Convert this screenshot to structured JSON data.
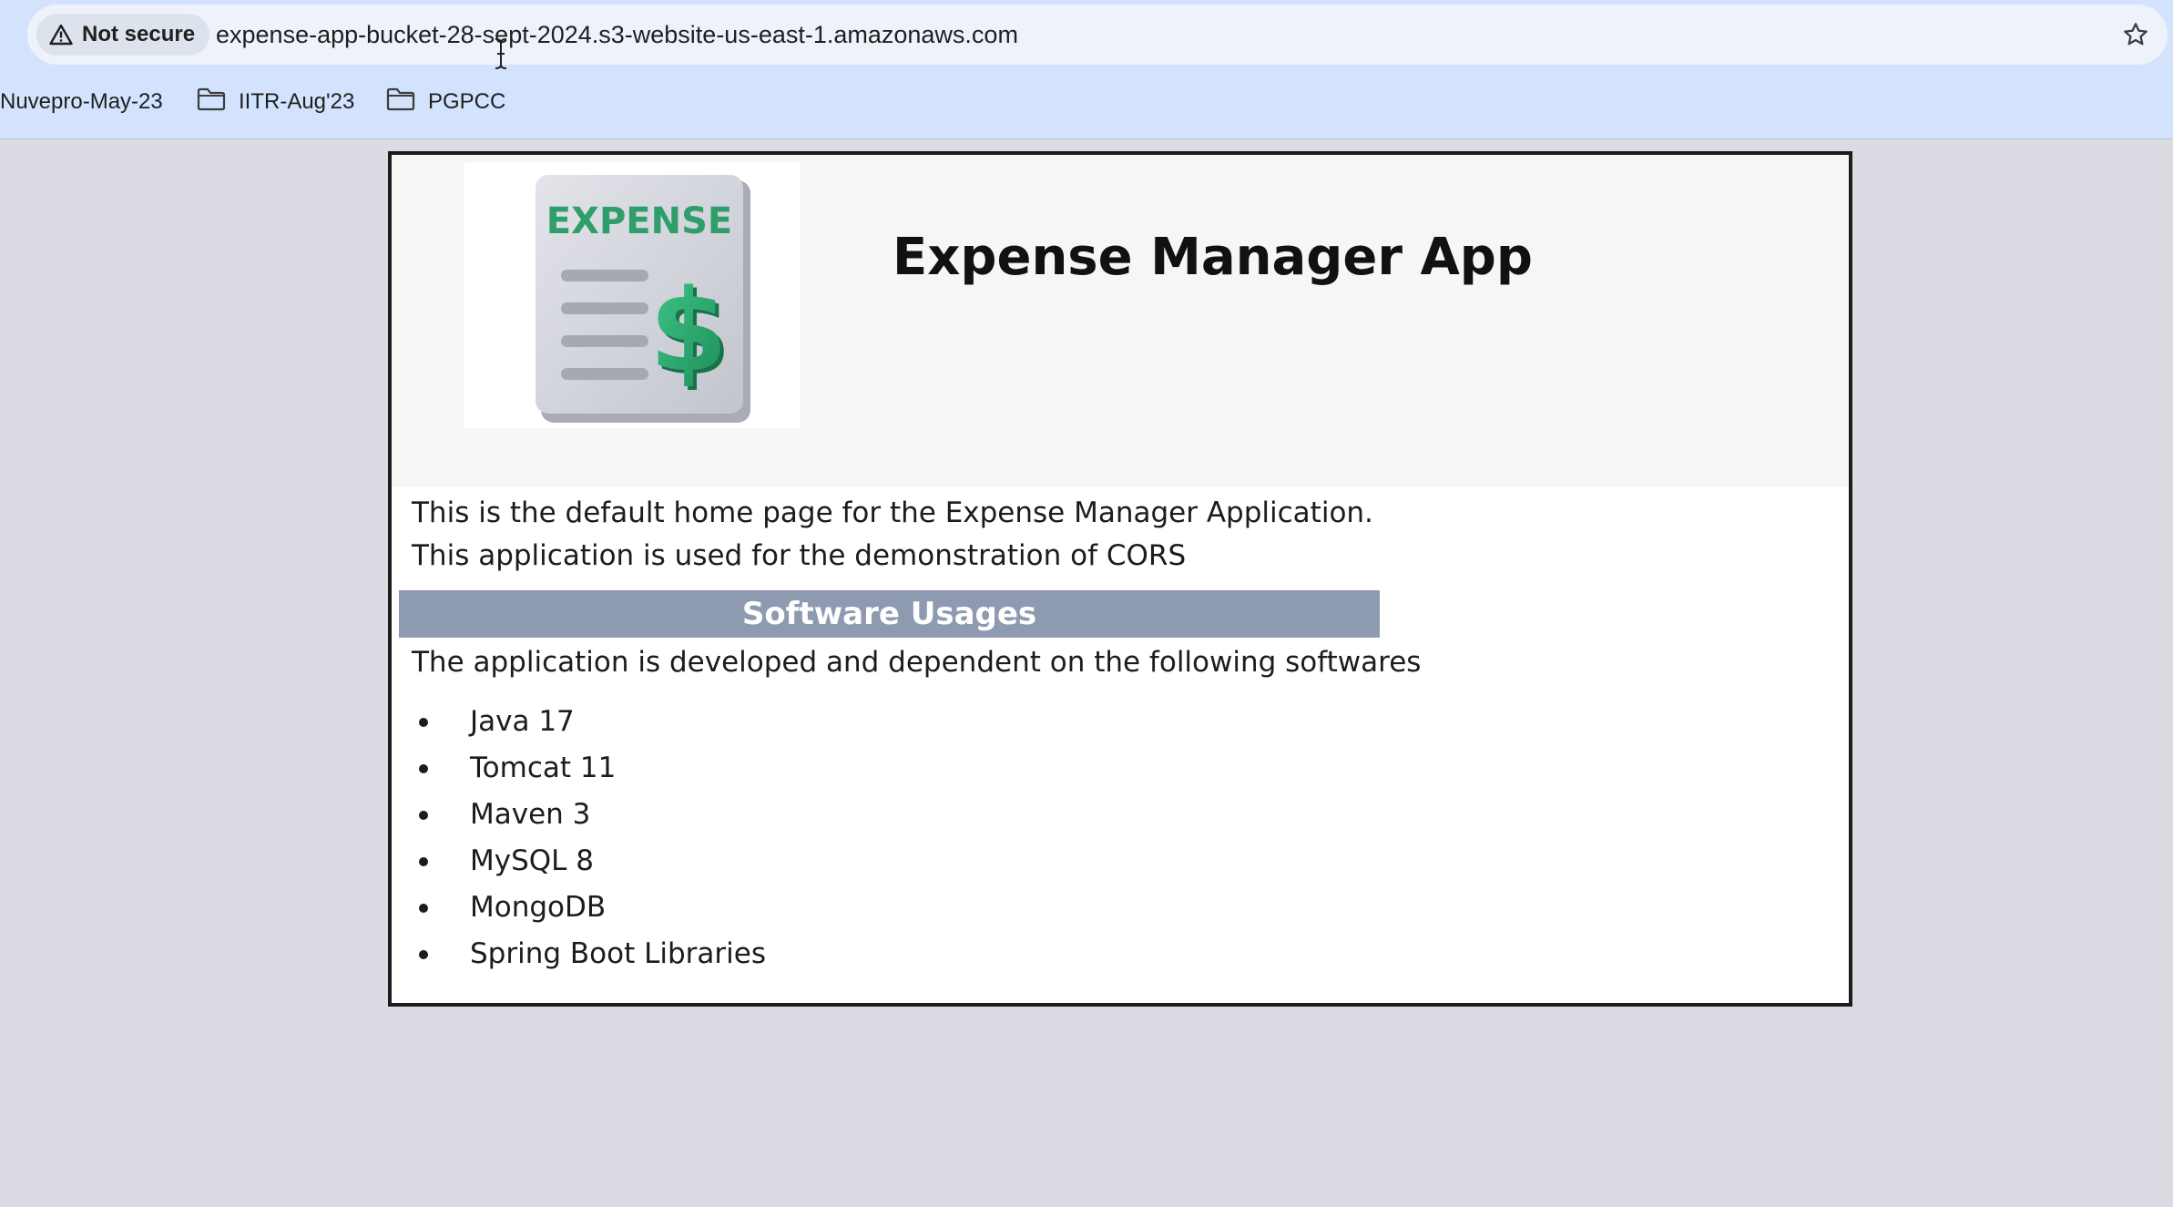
{
  "browser": {
    "security_label": "Not secure",
    "url": "expense-app-bucket-28-sept-2024.s3-website-us-east-1.amazonaws.com",
    "bookmarks": [
      {
        "label": "Nuvepro-May-23"
      },
      {
        "label": "IITR-Aug'23"
      },
      {
        "label": "PGPCC"
      }
    ]
  },
  "page": {
    "logo_text": "EXPENSE",
    "title": "Expense Manager App",
    "intro_lines": [
      "This is the default home page for the Expense Manager Application.",
      "This application is used for the demonstration of CORS"
    ],
    "section_heading": "Software Usages",
    "section_description": "The application is developed and dependent on the following softwares",
    "software_items": [
      "Java 17",
      "Tomcat 11",
      "Maven 3",
      "MySQL 8",
      "MongoDB",
      "Spring Boot Libraries"
    ]
  },
  "colors": {
    "chrome_background": "#d3e3fd",
    "page_background": "#dadbe3",
    "section_bar": "#8e9ab0",
    "logo_green": "#2bb673"
  }
}
